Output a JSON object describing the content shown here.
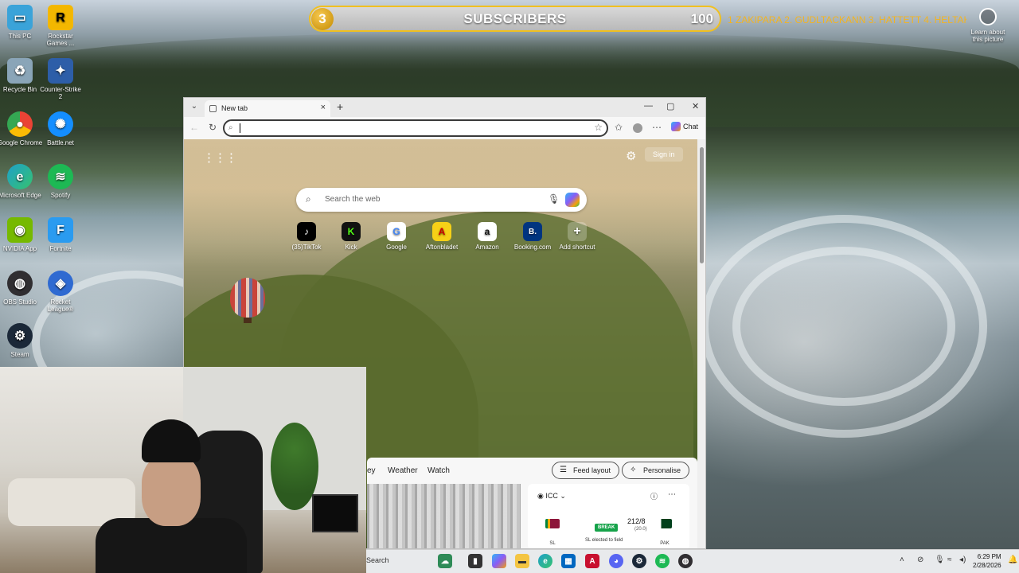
{
  "overlay": {
    "subscriber_count": "3",
    "subscriber_label": "SUBSCRIBERS",
    "subscriber_goal": "100",
    "ticker_text": "1 ZAKIPARA 2. GUDLTACKANN  3. HATTETT 4. HELTAKYNOM",
    "learn_label": "Learn about this picture"
  },
  "desktop_icons": [
    {
      "label": "This PC",
      "color": "#3aa3d9"
    },
    {
      "label": "Rockstar Games ...",
      "color": "#f3b700"
    },
    {
      "label": "Recycle Bin",
      "color": "#8aa5b8"
    },
    {
      "label": "Counter-Strike 2",
      "color": "#2d5ea8"
    },
    {
      "label": "Google Chrome",
      "color": "#e9453a"
    },
    {
      "label": "Battle.net",
      "color": "#148eff"
    },
    {
      "label": "Microsoft Edge",
      "color": "#1fa0c9"
    },
    {
      "label": "Spotify",
      "color": "#1db954"
    },
    {
      "label": "NVIDIA App",
      "color": "#76b900"
    },
    {
      "label": "Fortnite",
      "color": "#2a9bf0"
    },
    {
      "label": "OBS Studio",
      "color": "#302e31"
    },
    {
      "label": "Rocket League®",
      "color": "#2f6ad1"
    },
    {
      "label": "Steam",
      "color": "#1b2838"
    }
  ],
  "browser": {
    "tab_title": "New tab",
    "tab_close": "×",
    "new_tab": "+",
    "chat_label": "Chat",
    "address_value": "",
    "signin_label": "Sign in",
    "search_placeholder": "Search the web",
    "shortcuts": [
      {
        "label": "(35)TikTok",
        "glyph": "♪",
        "color": "#000000"
      },
      {
        "label": "Kick",
        "glyph": "K",
        "color": "#53fc18"
      },
      {
        "label": "Google",
        "glyph": "G",
        "color": "#4285f4"
      },
      {
        "label": "Aftonbladet",
        "glyph": "A",
        "color": "#f7d117"
      },
      {
        "label": "Amazon",
        "glyph": "a",
        "color": "#111111"
      },
      {
        "label": "Booking.com",
        "glyph": "B.",
        "color": "#003580"
      },
      {
        "label": "Add shortcut",
        "glyph": "+",
        "color": "#ffffff"
      }
    ],
    "feed": {
      "nav": [
        "ey",
        "Weather",
        "Watch"
      ],
      "feed_layout": "Feed layout",
      "personalise": "Personalise",
      "cricket": {
        "series": "ICC",
        "team1": "SL",
        "team2": "PAK",
        "status": "BREAK",
        "score": "212/8",
        "overs": "(20.0)",
        "note": "SL elected to field"
      }
    }
  },
  "taskbar": {
    "search_label": "Search",
    "time": "6:29 PM",
    "date": "2/28/2026"
  }
}
